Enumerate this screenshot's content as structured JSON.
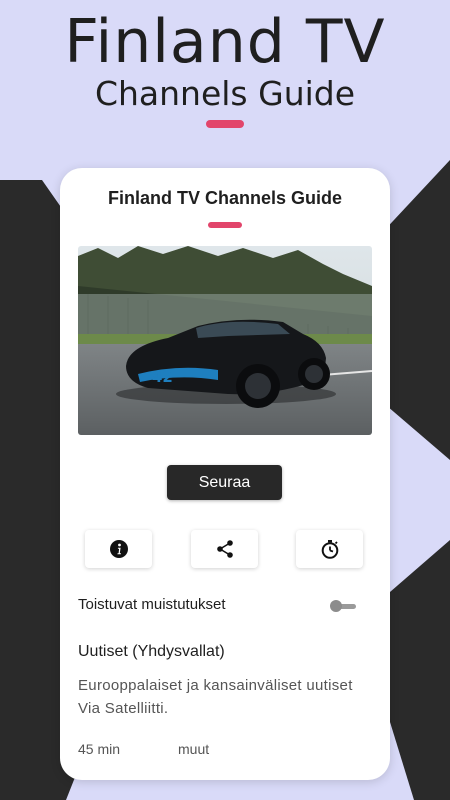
{
  "hero": {
    "title": "Finland TV",
    "subtitle": "Channels Guide",
    "accent_color": "#e2456b"
  },
  "card": {
    "title": "Finland TV Channels Guide",
    "image_alt": "car-photo",
    "follow_label": "Seuraa",
    "actions": [
      {
        "icon": "info-icon"
      },
      {
        "icon": "share-icon"
      },
      {
        "icon": "timer-icon"
      }
    ],
    "reminder_label": "Toistuvat muistutukset",
    "reminder_enabled": false,
    "program_title": "Uutiset (Yhdysvallat)",
    "program_description": "Eurooppalaiset ja kansainväliset uutiset Via Satelliitti.",
    "duration": "45 min",
    "category": "muut"
  }
}
